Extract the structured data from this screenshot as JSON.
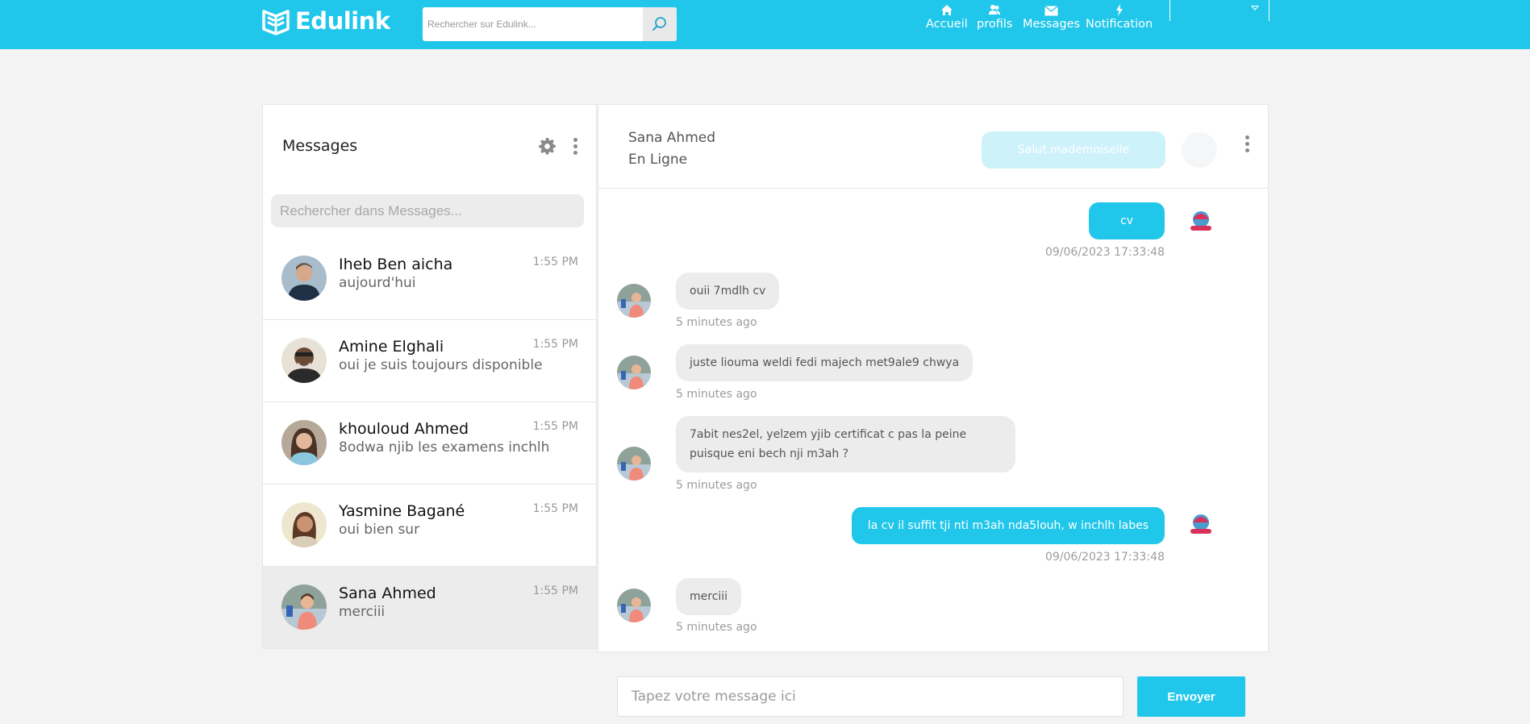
{
  "brand": {
    "name": "Edulink",
    "accent": "#21c7ea",
    "logo_icon": "book-logo-icon"
  },
  "header": {
    "search_placeholder": "Rechercher sur Edulink...",
    "search_icon": "search-icon",
    "nav": [
      {
        "label": "Accueil",
        "icon": "home-icon"
      },
      {
        "label": "profils",
        "icon": "users-icon"
      },
      {
        "label": "Messages",
        "icon": "envelope-icon"
      },
      {
        "label": "Notification",
        "icon": "bolt-icon"
      }
    ]
  },
  "sidebar": {
    "title": "Messages",
    "search_placeholder": "Rechercher dans Messages...",
    "conversations": [
      {
        "name": "Iheb Ben aicha",
        "last": "aujourd'hui",
        "time": "1:55 PM",
        "active": false
      },
      {
        "name": "Amine Elghali",
        "last": "oui je suis toujours disponible",
        "time": "1:55 PM",
        "active": false
      },
      {
        "name": "khouloud Ahmed",
        "last": "8odwa njib les examens inchlh",
        "time": "1:55 PM",
        "active": false
      },
      {
        "name": "Yasmine Bagané",
        "last": "oui bien sur",
        "time": "1:55 PM",
        "active": false
      },
      {
        "name": "Sana Ahmed",
        "last": "merciii",
        "time": "1:55 PM",
        "active": true
      }
    ]
  },
  "chat": {
    "contact_name": "Sana Ahmed",
    "contact_status": "En Ligne",
    "ghost_bubble": "Salut mademoiselle",
    "messages": [
      {
        "dir": "out",
        "text": "cv",
        "meta": "09/06/2023 17:33:48"
      },
      {
        "dir": "in",
        "text": "ouii 7mdlh cv",
        "meta": "5 minutes ago"
      },
      {
        "dir": "in",
        "text": "juste liouma weldi fedi majech met9ale9 chwya",
        "meta": "5 minutes ago"
      },
      {
        "dir": "in",
        "text": "7abit nes2el, yelzem yjib certificat c pas la peine puisque eni bech nji m3ah ?",
        "meta": "5 minutes ago"
      },
      {
        "dir": "out",
        "text": "la cv il suffit tji nti m3ah nda5louh, w inchlh labes",
        "meta": "09/06/2023 17:33:48"
      },
      {
        "dir": "in",
        "text": "merciii",
        "meta": "5 minutes ago"
      }
    ],
    "composer_placeholder": "Tapez votre message ici",
    "send_label": "Envoyer"
  }
}
